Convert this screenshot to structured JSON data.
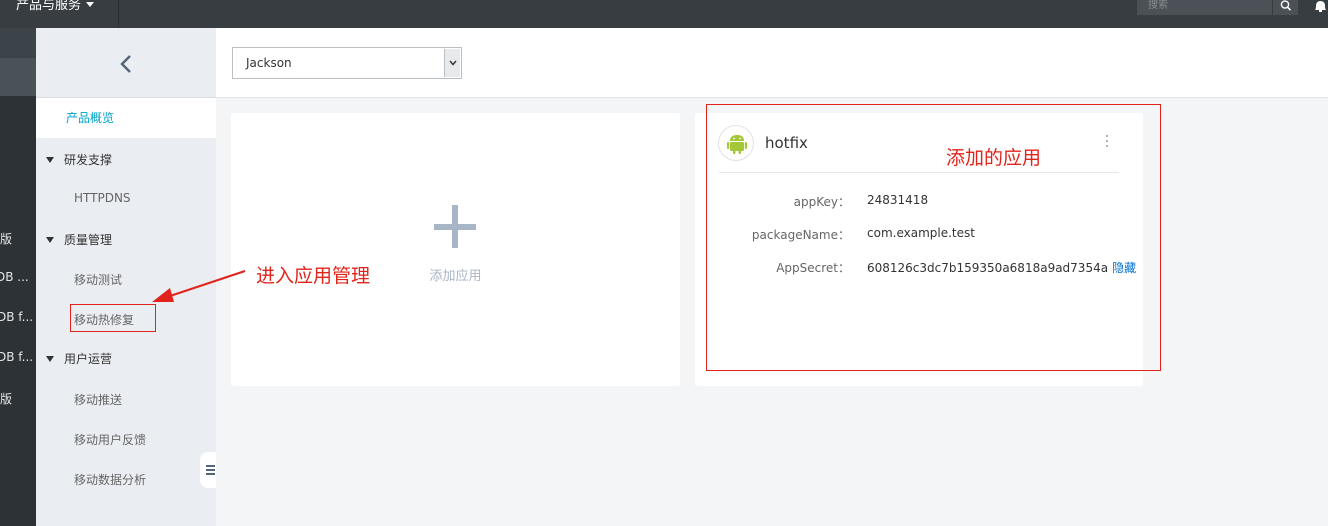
{
  "topbar": {
    "products_label": "产品与服务",
    "search_placeholder": "搜索"
  },
  "darkstrip": {
    "items": [
      "版",
      "DB ...",
      "DB f...",
      "DB f...",
      "版"
    ]
  },
  "sidebar": {
    "active_item": "产品概览",
    "groups": [
      {
        "label": "研发支撑",
        "items": [
          "HTTPDNS"
        ]
      },
      {
        "label": "质量管理",
        "items": [
          "移动测试",
          "移动热修复"
        ]
      },
      {
        "label": "用户运营",
        "items": [
          "移动推送",
          "移动用户反馈",
          "移动数据分析"
        ]
      }
    ]
  },
  "header": {
    "account_select_value": "Jackson"
  },
  "add_card": {
    "label": "添加应用"
  },
  "app_card": {
    "name": "hotfix",
    "fields": [
      {
        "key": "appKey：",
        "value": "24831418"
      },
      {
        "key": "packageName：",
        "value": "com.example.test"
      },
      {
        "key": "AppSecret：",
        "value": "608126c3dc7b159350a6818a9ad7354a"
      }
    ],
    "hide_link": "隐藏"
  },
  "annotations": {
    "enter_app_mgmt": "进入应用管理",
    "added_app": "添加的应用",
    "color": "#e2231a"
  },
  "colors": {
    "topbar": "#373d41",
    "accent": "#00a2ca",
    "link": "#0070cc",
    "android": "#a4c639"
  }
}
